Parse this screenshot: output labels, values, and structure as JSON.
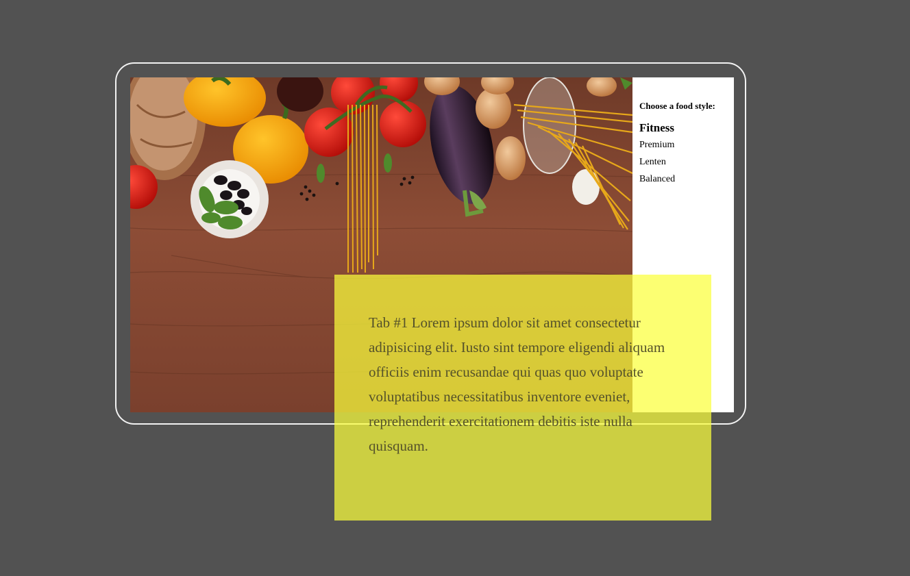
{
  "sidebar": {
    "heading": "Choose a food style:",
    "items": [
      {
        "label": "Fitness",
        "active": true
      },
      {
        "label": "Premium",
        "active": false
      },
      {
        "label": "Lenten",
        "active": false
      },
      {
        "label": "Balanced",
        "active": false
      }
    ]
  },
  "tab": {
    "text": "Tab #1 Lorem ipsum dolor sit amet consectetur adipisicing elit. Iusto sint tempore eligendi aliquam officiis enim recusandae qui quas quo voluptate voluptatibus necessitatibus inventore eveniet, reprehenderit exercitationem debitis iste nulla quisquam."
  },
  "colors": {
    "page_background": "#525252",
    "frame_border": "#f2f2f2",
    "tab_panel": "#fbff3b",
    "sidebar_background": "#ffffff"
  },
  "icons": {
    "photo": "food-photo-vegetables-on-wooden-table"
  }
}
